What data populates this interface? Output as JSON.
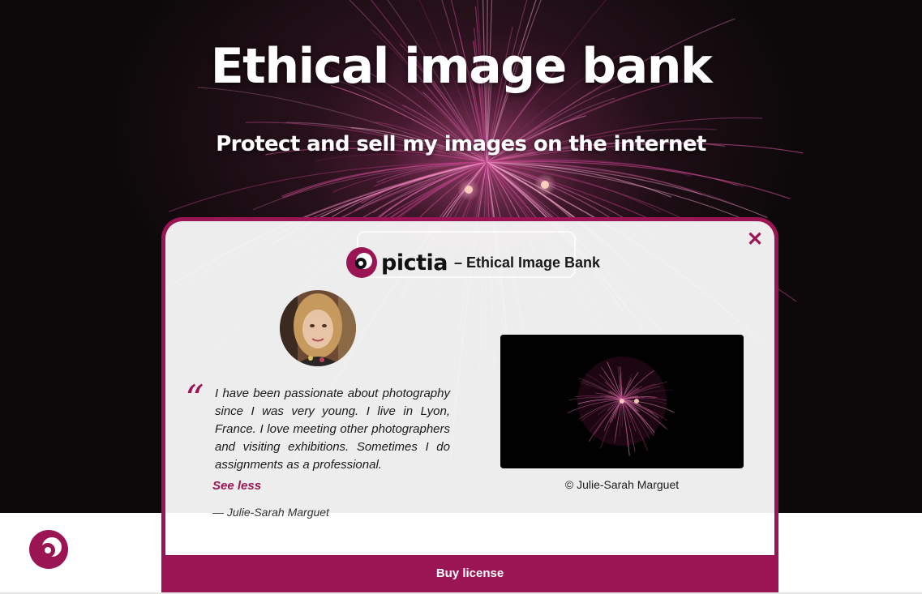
{
  "hero": {
    "title": "Ethical image bank",
    "subtitle": "Protect and sell my images on the internet"
  },
  "modal": {
    "brand_name": "pictia",
    "brand_tagline": "– Ethical Image Bank",
    "close_icon": "close-icon",
    "testimonial": {
      "quote": "I have been passionate about photography since I was very young. I live in Lyon, France. I love meeting other photographers and visiting exhibitions. Sometimes I do assignments as a professional.",
      "toggle_label": "See less",
      "author": "— Julie-Sarah Marguet"
    },
    "photo_caption": "© Julie-Sarah Marguet",
    "buy_label": "Buy license"
  },
  "colors": {
    "accent": "#9b1454",
    "hero_bg": "#0d090a",
    "modal_bg": "#f6f6f6"
  }
}
